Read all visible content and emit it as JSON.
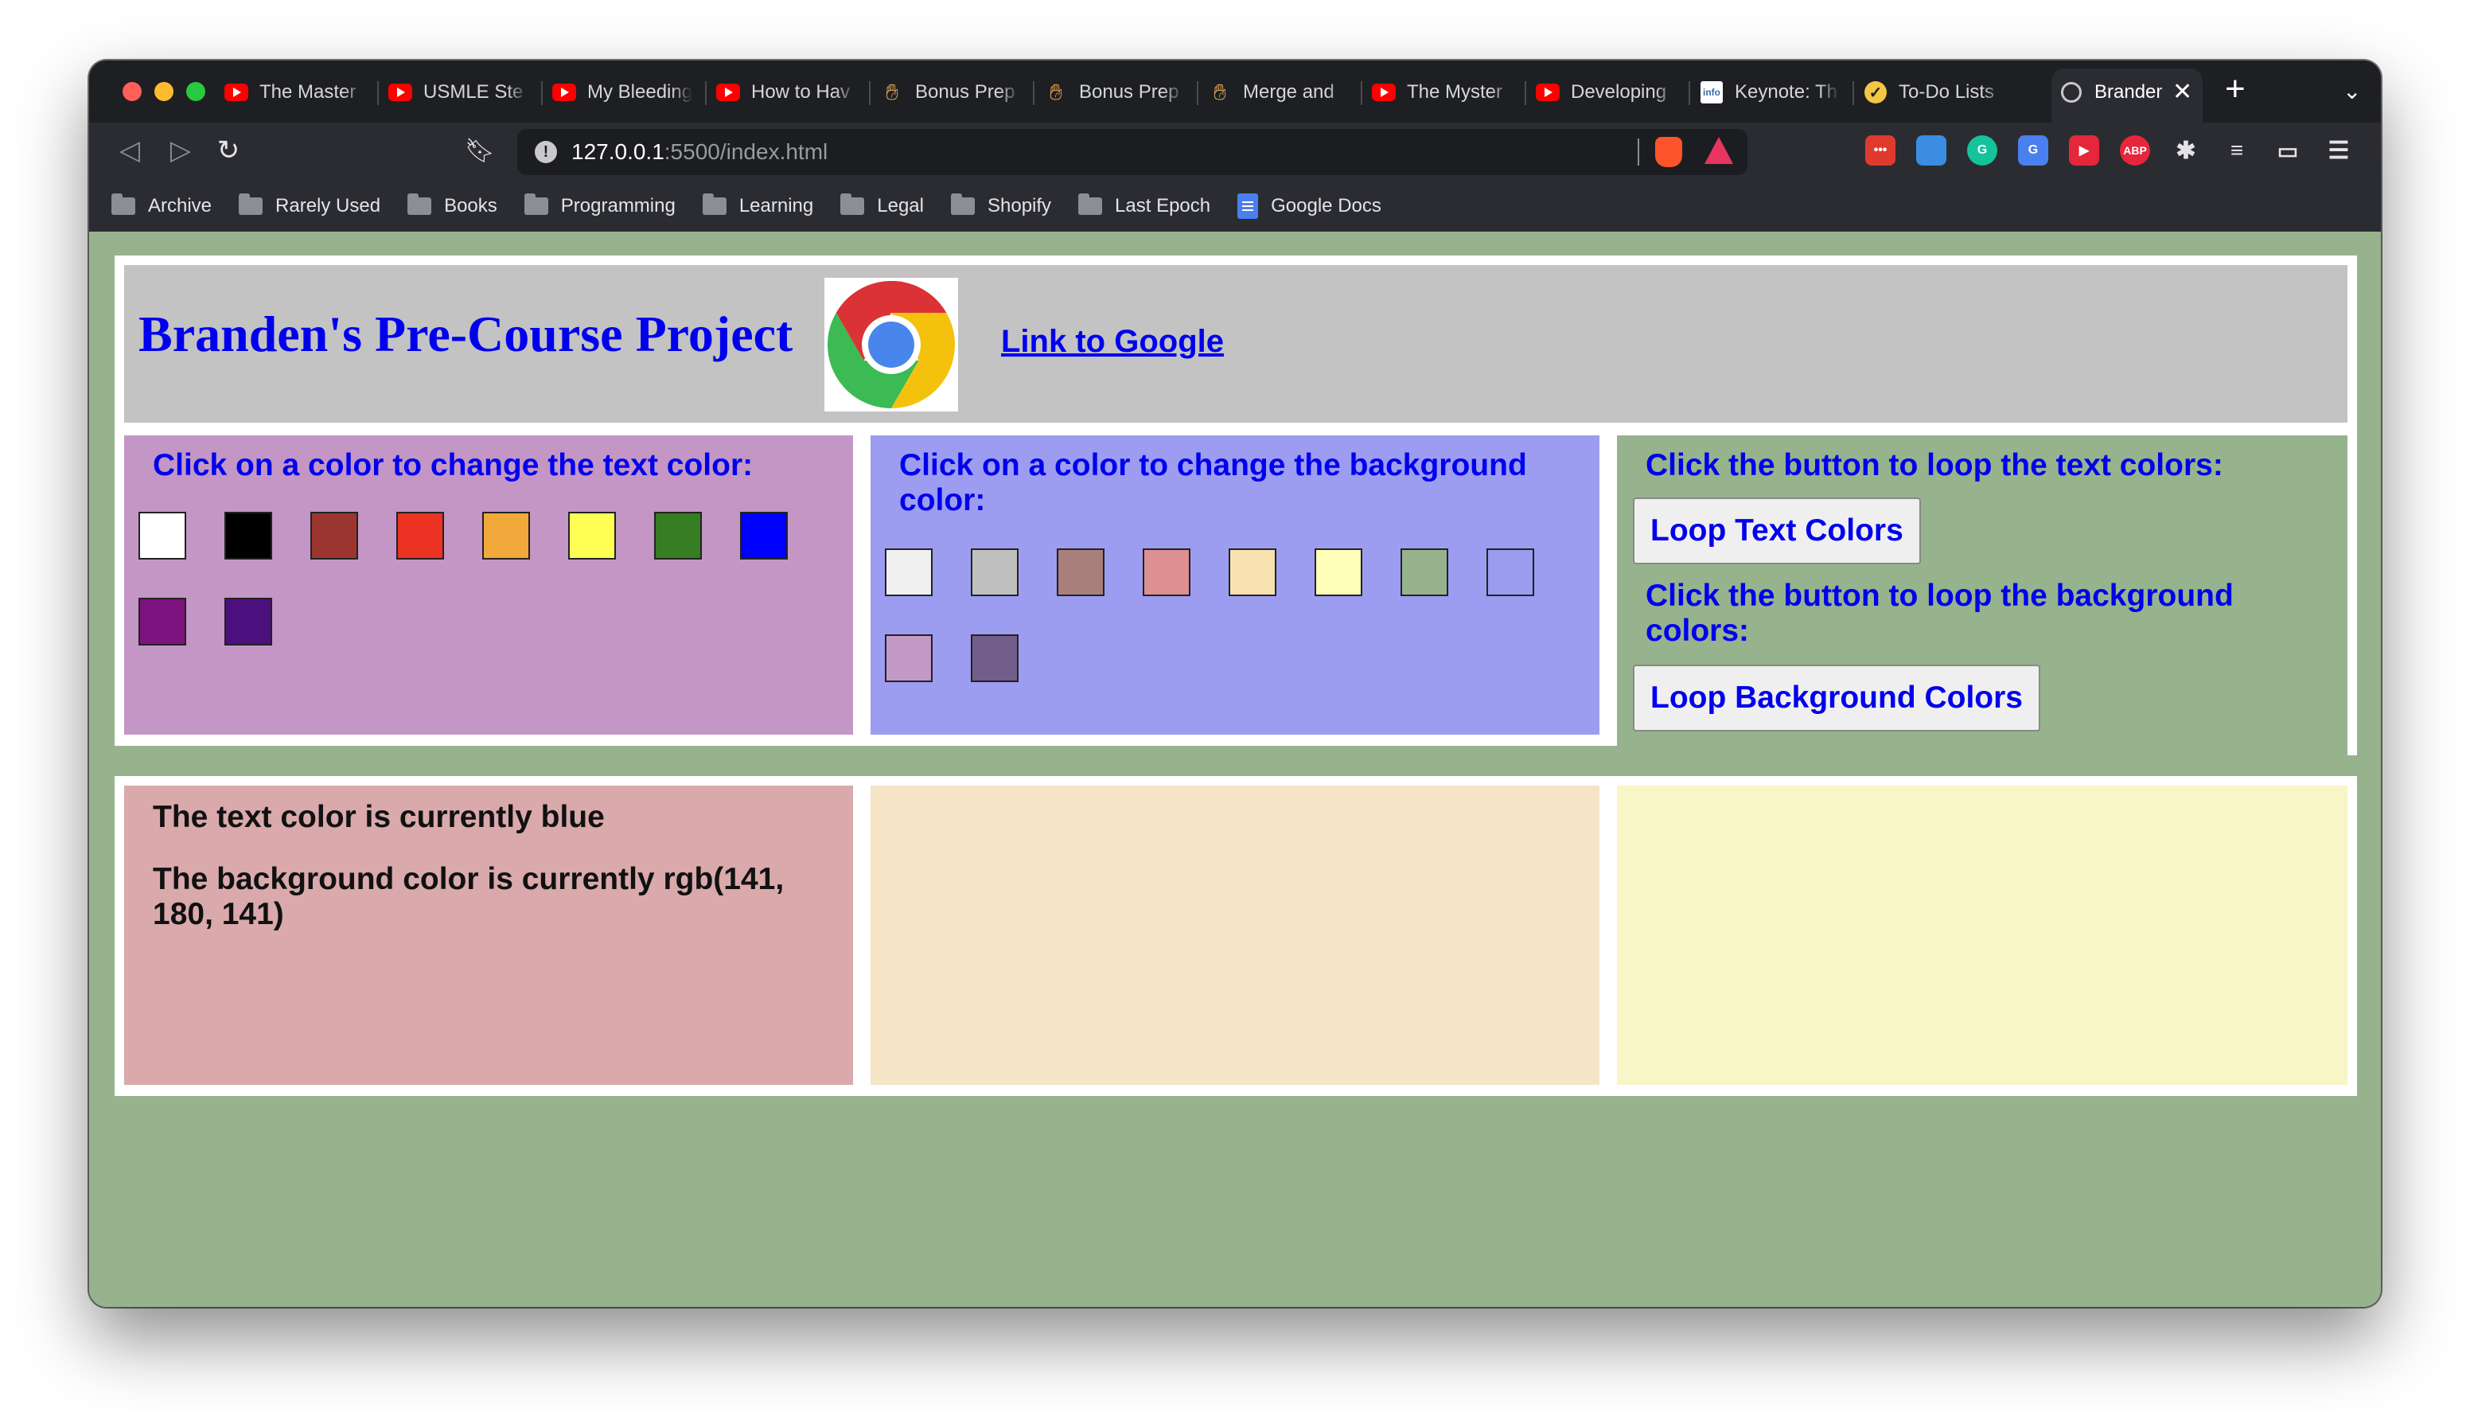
{
  "browser": {
    "tabs": [
      {
        "label": "The Master",
        "icon": "youtube-icon"
      },
      {
        "label": "USMLE Ste",
        "icon": "youtube-icon"
      },
      {
        "label": "My Bleeding",
        "icon": "youtube-icon"
      },
      {
        "label": "How to Hav",
        "icon": "youtube-icon"
      },
      {
        "label": "Bonus Prep",
        "icon": "hand-icon"
      },
      {
        "label": "Bonus Prep",
        "icon": "hand-icon"
      },
      {
        "label": "Merge and",
        "icon": "hand-icon"
      },
      {
        "label": "The Myster",
        "icon": "youtube-icon"
      },
      {
        "label": "Developing",
        "icon": "youtube-icon"
      },
      {
        "label": "Keynote: Th",
        "icon": "info-icon"
      },
      {
        "label": "To-Do Lists",
        "icon": "check-icon"
      },
      {
        "label": "Brander",
        "icon": "globe-icon"
      }
    ],
    "url_host": "127.0.0.1",
    "url_rest": ":5500/index.html",
    "bookmarks": [
      "Archive",
      "Rarely Used",
      "Books",
      "Programming",
      "Learning",
      "Legal",
      "Shopify",
      "Last Epoch",
      "Google Docs"
    ]
  },
  "page": {
    "title": "Branden's Pre-Course Project",
    "link_text": "Link to Google",
    "text_panel_title": "Click on a color to change the text color:",
    "bg_panel_title": "Click on a color to change the background color:",
    "loop_text_title": "Click the button to loop the text colors:",
    "loop_text_button": "Loop Text Colors",
    "loop_bg_title": "Click the button to loop the background colors:",
    "loop_bg_button": "Loop Background Colors",
    "status_text": "The text color is currently blue",
    "status_bg": "The background color is currently rgb(141, 180, 141)"
  },
  "colors": {
    "text_swatches": [
      "#ffffff",
      "#000000",
      "#9b3530",
      "#ec3323",
      "#f2a93b",
      "#fffe54",
      "#367d23",
      "#0000ff",
      "#7d137f",
      "#4b0f7e"
    ],
    "bg_swatches": [
      "#f0f0f0",
      "#c0c0c0",
      "#a87f7d",
      "#dc9092",
      "#f9e2b1",
      "#fefeb8",
      "#96b38d",
      "#9b9cf0",
      "#c399c6",
      "#735d8a"
    ],
    "accent_link": "#0000ee"
  }
}
